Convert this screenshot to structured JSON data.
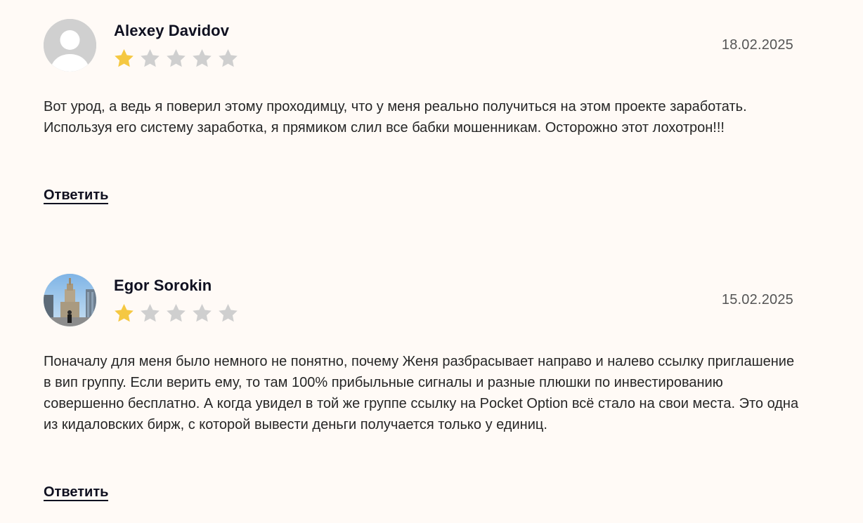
{
  "reviews": [
    {
      "author": "Alexey Davidov",
      "date": "18.02.2025",
      "rating": 1,
      "max_rating": 5,
      "avatar": "default-user-icon",
      "text": "Вот урод, а ведь я поверил этому проходимцу, что у меня реально получиться на этом проекте заработать. Используя его систему заработка, я прямиком слил все бабки мошенникам. Осторожно этот лохотрон!!!",
      "reply_label": "Ответить"
    },
    {
      "author": "Egor Sorokin",
      "date": "15.02.2025",
      "rating": 1,
      "max_rating": 5,
      "avatar": "user-photo",
      "text": "Поначалу для меня было немного не понятно, почему Женя разбрасывает направо и налево ссылку приглашение в вип группу. Если верить ему, то там 100% прибыльные сигналы и разные плюшки по инвестированию совершенно бесплатно. А когда увидел в той же группе ссылку на Pocket Option всё стало на свои места. Это одна из кидаловских бирж, с которой вывести деньги получается только у единиц.",
      "reply_label": "Ответить"
    }
  ],
  "colors": {
    "background": "#fffaf6",
    "star_filled": "#f5c842",
    "star_empty": "#cfcfcf",
    "text": "#262626",
    "heading": "#0f1020"
  }
}
